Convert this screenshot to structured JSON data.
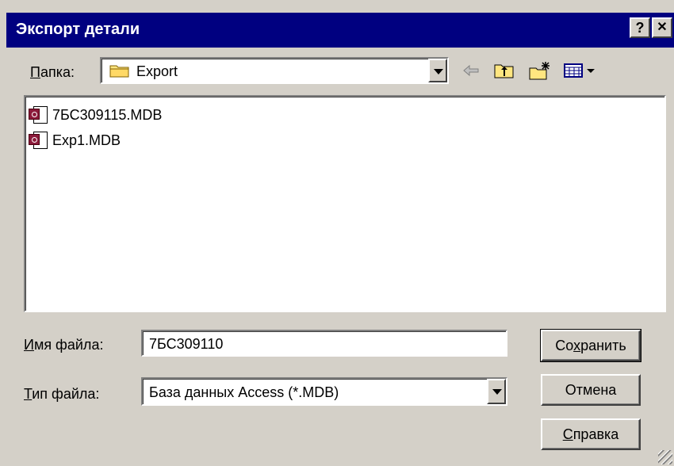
{
  "window": {
    "title": "Экспорт детали",
    "help_btn": "?",
    "close_btn": "✕"
  },
  "folder": {
    "label_u": "П",
    "label_rest": "апка:",
    "value": "Export"
  },
  "files": [
    {
      "name": "7БС309115.MDB"
    },
    {
      "name": "Exp1.MDB"
    }
  ],
  "filename": {
    "label_u": "И",
    "label_rest": "мя файла:",
    "value": "7БС309110"
  },
  "filetype": {
    "label_u": "Т",
    "label_rest": "ип файла:",
    "value": "База данных Access (*.MDB)"
  },
  "buttons": {
    "save_pre": "Со",
    "save_u": "х",
    "save_post": "ранить",
    "cancel": "Отмена",
    "help_u": "С",
    "help_post": "правка"
  },
  "icons": {
    "back": "back-arrow-icon",
    "up": "up-folder-icon",
    "new": "new-folder-icon",
    "view": "view-menu-icon",
    "file": "access-database-file-icon",
    "folder": "folder-icon"
  }
}
